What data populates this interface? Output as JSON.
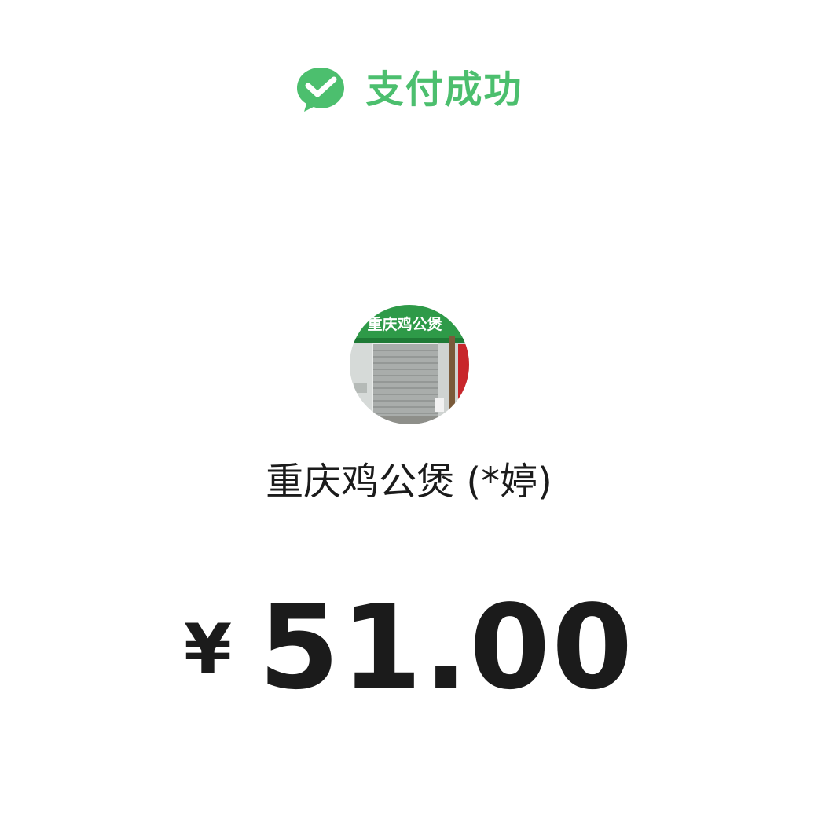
{
  "status": {
    "icon": "wechat-pay-success-icon",
    "text": "支付成功",
    "color": "#4cbf6e"
  },
  "merchant": {
    "avatar_icon": "storefront-photo",
    "sign_text": "重庆鸡公煲",
    "name": "重庆鸡公煲 (*婷)"
  },
  "payment": {
    "currency_symbol": "¥",
    "amount": "51.00"
  }
}
